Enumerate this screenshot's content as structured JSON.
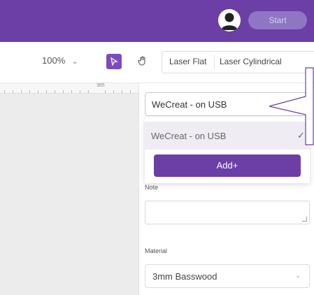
{
  "header": {
    "avatar_icon": "user-avatar-icon",
    "start_label": "Start"
  },
  "toolbar": {
    "zoom_value": "100%",
    "zoom_chevron": "⌄",
    "pointer_icon": "cursor-arrow-icon",
    "pan_icon": "hand-icon",
    "modes": [
      "Laser Flat",
      "Laser Cylindrical"
    ]
  },
  "canvas": {
    "ruler_label": "385"
  },
  "device": {
    "selected": "WeCreat - on USB",
    "options": [
      {
        "label": "WeCreat - on USB",
        "selected": true
      }
    ],
    "add_label": "Add+"
  },
  "note": {
    "label": "Note",
    "value": ""
  },
  "material": {
    "label": "Material",
    "value": "3mm Basswood"
  },
  "colors": {
    "accent": "#6b3fa6",
    "start_button": "#8e76c4"
  }
}
